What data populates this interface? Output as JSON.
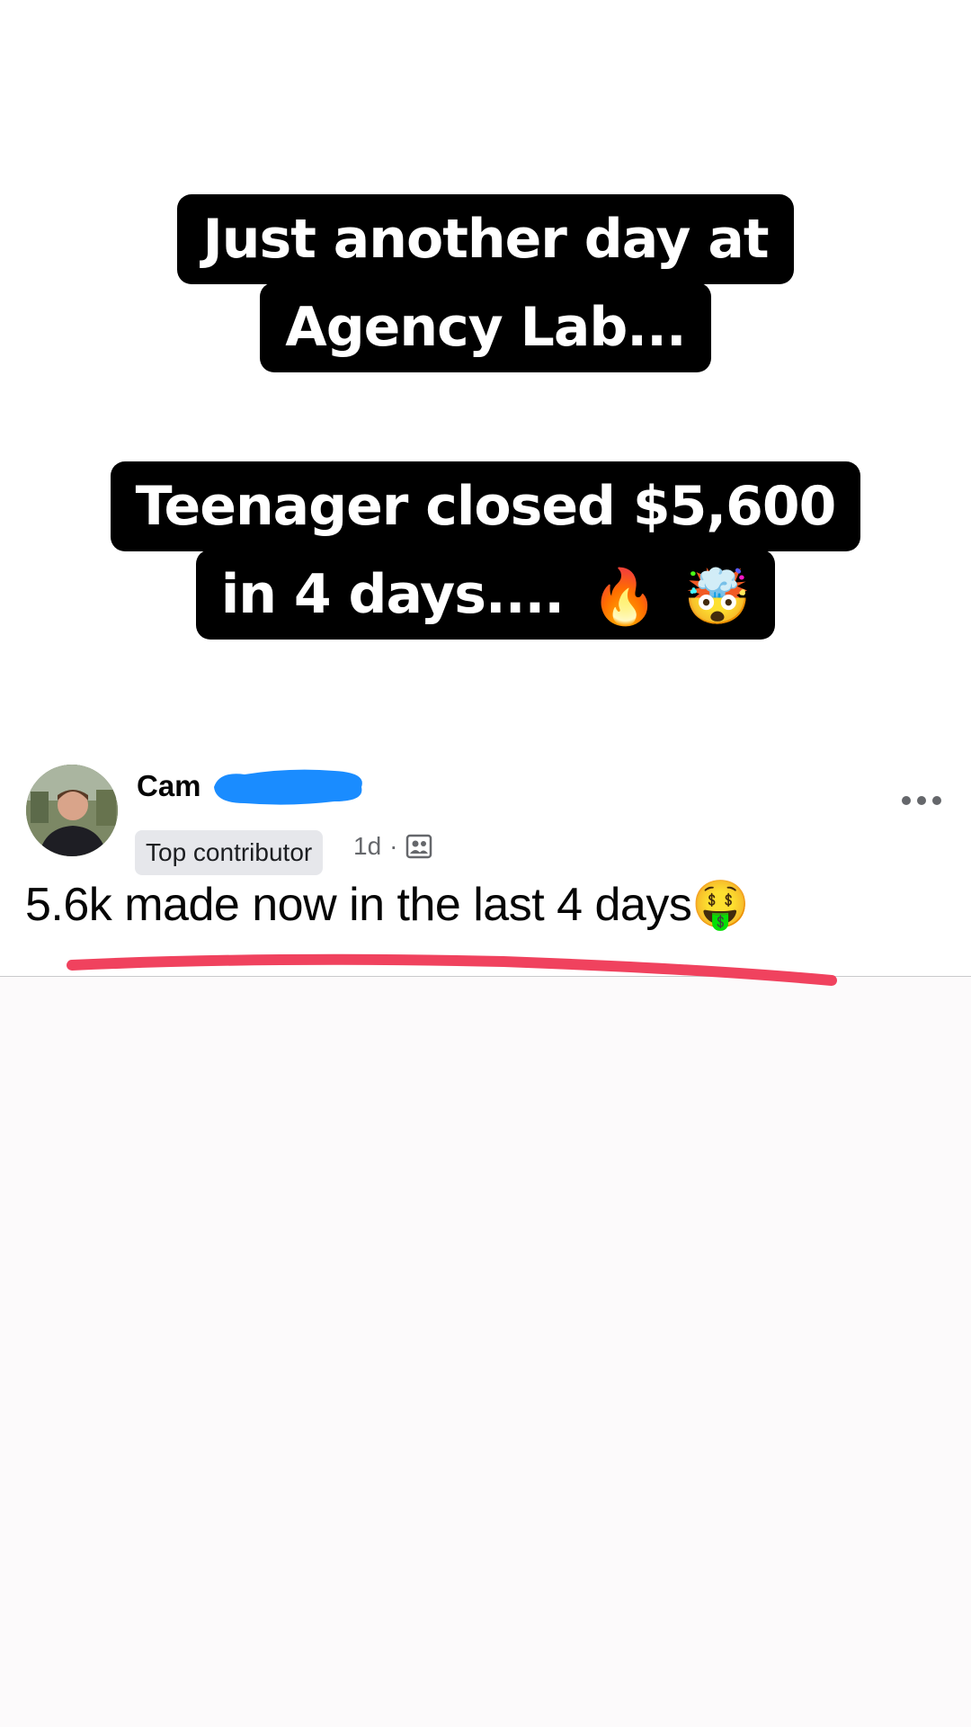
{
  "caption": {
    "line1a": "Just another day at",
    "line1b": "Agency Lab...",
    "line2a": "Teenager closed $5,600",
    "line2b": "in 4 days....",
    "emoji_fire": "🔥",
    "emoji_mind_blown": "🤯"
  },
  "post": {
    "author_name": "Cam",
    "badge": "Top contributor",
    "time": "1d",
    "meta_separator": "·",
    "body": "5.6k made now in the last 4 days",
    "body_emoji": "🤑",
    "avatar_icon": "profile-photo",
    "privacy_icon": "group-members-icon",
    "more_icon": "more-options-icon"
  },
  "colors": {
    "caption_bg": "#000000",
    "caption_text": "#ffffff",
    "redaction": "#1a8cff",
    "underline": "#f0425e"
  }
}
